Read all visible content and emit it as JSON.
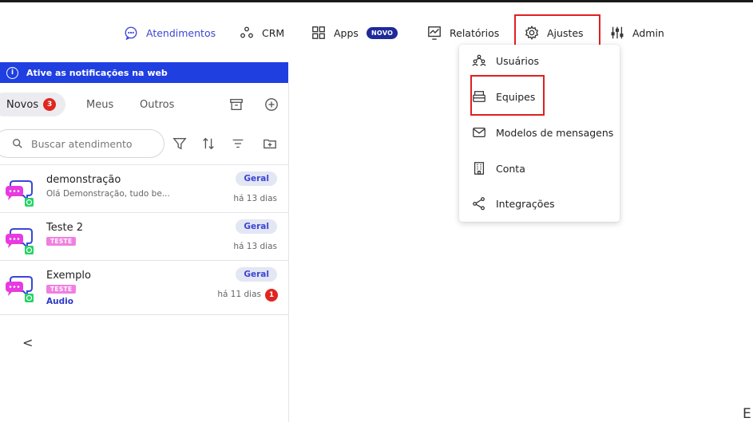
{
  "nav": {
    "items": [
      {
        "label": "Atendimentos",
        "icon": "chat-bubble-icon",
        "active": true
      },
      {
        "label": "CRM",
        "icon": "nodes-icon"
      },
      {
        "label": "Apps",
        "icon": "grid-icon",
        "badge": "NOVO"
      },
      {
        "label": "Relatórios",
        "icon": "chart-icon"
      },
      {
        "label": "Ajustes",
        "icon": "gear-icon"
      },
      {
        "label": "Admin",
        "icon": "sliders-icon"
      }
    ]
  },
  "banner": {
    "text": "Ative as notificações na web"
  },
  "tabs": [
    {
      "label": "Novos",
      "count": "3"
    },
    {
      "label": "Meus"
    },
    {
      "label": "Outros"
    }
  ],
  "search": {
    "placeholder": "Buscar atendimento"
  },
  "conversations": [
    {
      "name": "demonstração",
      "preview": "Olá Demonstração, tudo be...",
      "queue": "Geral",
      "time": "há 13 dias"
    },
    {
      "name": "Teste 2",
      "tag": "TESTE",
      "queue": "Geral",
      "time": "há 13 dias"
    },
    {
      "name": "Exemplo",
      "tag": "TESTE",
      "subtitle": "Audio",
      "queue": "Geral",
      "time": "há 11 dias",
      "unread": "1"
    }
  ],
  "back_label": "<",
  "dropdown": {
    "items": [
      {
        "label": "Usuários",
        "icon": "users-icon"
      },
      {
        "label": "Equipes",
        "icon": "team-icon"
      },
      {
        "label": "Modelos de mensagens",
        "icon": "mail-icon"
      },
      {
        "label": "Conta",
        "icon": "building-icon"
      },
      {
        "label": "Integrações",
        "icon": "share-icon"
      }
    ]
  },
  "corner_text": "E",
  "colors": {
    "accent": "#3b46d6",
    "banner": "#1f3fe0",
    "highlight_box": "#e02020",
    "tag_teste": "#f07fe0",
    "badge_red": "#e0261e",
    "whatsapp": "#25d366",
    "chat_pink": "#e83ae0"
  }
}
